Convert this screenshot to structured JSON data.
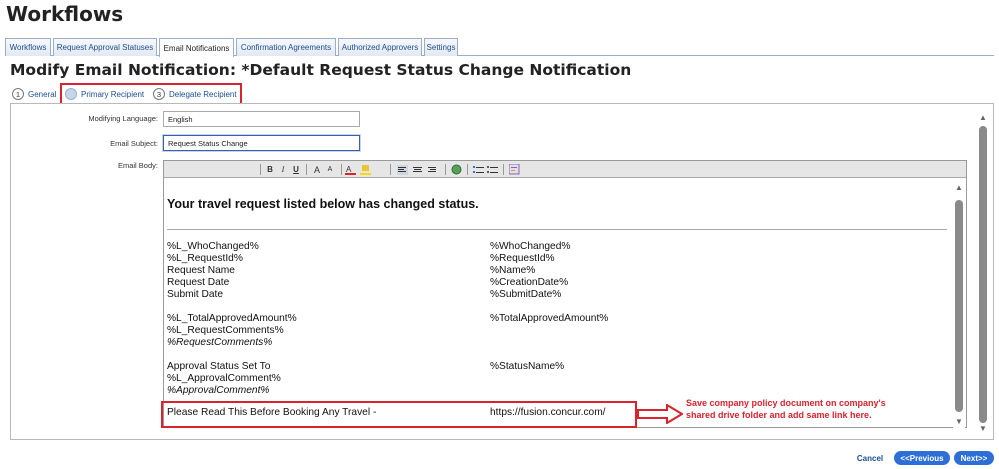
{
  "app": {
    "title": "Workflows"
  },
  "tabs": [
    {
      "label": "Workflows"
    },
    {
      "label": "Request Approval Statuses"
    },
    {
      "label": "Email Notifications"
    },
    {
      "label": "Confirmation Agreements"
    },
    {
      "label": "Authorized Approvers"
    },
    {
      "label": "Settings"
    }
  ],
  "page": {
    "title": "Modify Email Notification: *Default Request Status Change Notification"
  },
  "steps": [
    {
      "num": "1",
      "label": "General"
    },
    {
      "num": "2",
      "label": "Primary Recipient"
    },
    {
      "num": "3",
      "label": "Delegate Recipient"
    }
  ],
  "form": {
    "language_label": "Modifying Language:",
    "language_value": "English",
    "subject_label": "Email Subject:",
    "subject_value": "Request Status Change",
    "body_label": "Email Body:"
  },
  "toolbar": {
    "bold": "B",
    "italic": "I",
    "underline": "U",
    "font_size_up": "A",
    "font_size_down": "A"
  },
  "email": {
    "heading": "Your travel request listed below has changed status.",
    "rows": [
      {
        "left": "%L_WhoChanged%",
        "right": "%WhoChanged%"
      },
      {
        "left": "%L_RequestId%",
        "right": "%RequestId%"
      },
      {
        "left": "Request Name",
        "right": "%Name%"
      },
      {
        "left": "Request Date",
        "right": "%CreationDate%"
      },
      {
        "left": "Submit Date",
        "right": "%SubmitDate%"
      },
      {
        "left": "%L_TotalApprovedAmount%",
        "right": "%TotalApprovedAmount%"
      },
      {
        "left": "%L_RequestComments%",
        "right": ""
      },
      {
        "left": "%RequestComments%",
        "right": ""
      },
      {
        "left": "Approval Status Set To",
        "right": "%StatusName%"
      },
      {
        "left": "%L_ApprovalComment%",
        "right": ""
      },
      {
        "left": "%ApprovalComment%",
        "right": ""
      },
      {
        "left": "Please Read This Before Booking Any Travel -",
        "right": "https://fusion.concur.com/"
      }
    ]
  },
  "annotation": {
    "line1": "Save company policy document on company's",
    "line2": "shared drive folder and add same link here."
  },
  "buttons": {
    "cancel": "Cancel",
    "previous": "<<Previous",
    "next": "Next>>"
  },
  "colors": {
    "accent": "#2d6fd7",
    "highlight": "#d9232d"
  }
}
